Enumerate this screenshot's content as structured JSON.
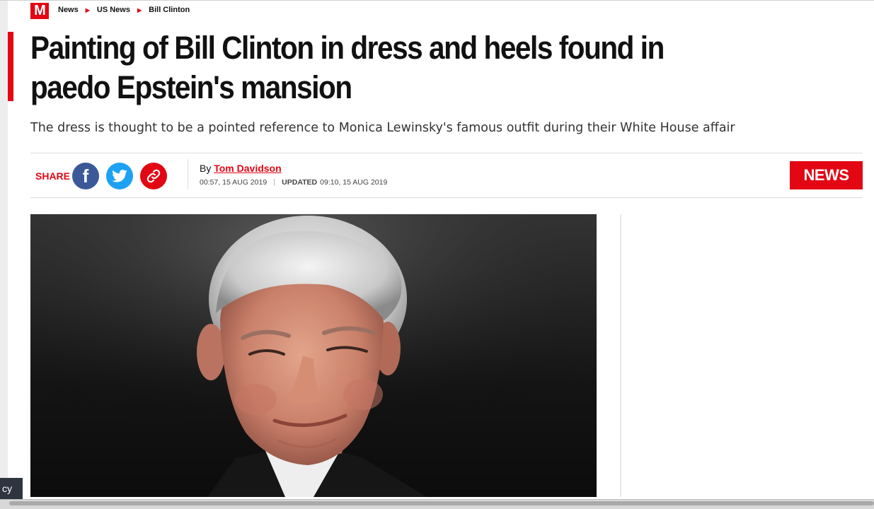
{
  "brand": {
    "logo_text": "M",
    "accent_color": "#e30613"
  },
  "breadcrumb": [
    {
      "label": "News"
    },
    {
      "label": "US News"
    },
    {
      "label": "Bill Clinton"
    }
  ],
  "article": {
    "headline": "Painting of Bill Clinton in dress and heels found in paedo Epstein's mansion",
    "standfirst": "The dress is thought to be a pointed reference to Monica Lewinsky's famous outfit during their White House affair",
    "byline_prefix": "By",
    "author": "Tom Davidson",
    "published": "00:57, 15 AUG 2019",
    "updated_label": "UPDATED",
    "updated": "09:10, 15 AUG 2019",
    "section_badge": "NEWS"
  },
  "share": {
    "label": "SHARE",
    "buttons": [
      {
        "icon": "facebook-icon",
        "color": "#3b5998"
      },
      {
        "icon": "twitter-icon",
        "color": "#1da1f2"
      },
      {
        "icon": "link-icon",
        "color": "#e30613"
      }
    ]
  },
  "privacy_tab": {
    "label": "cy"
  }
}
